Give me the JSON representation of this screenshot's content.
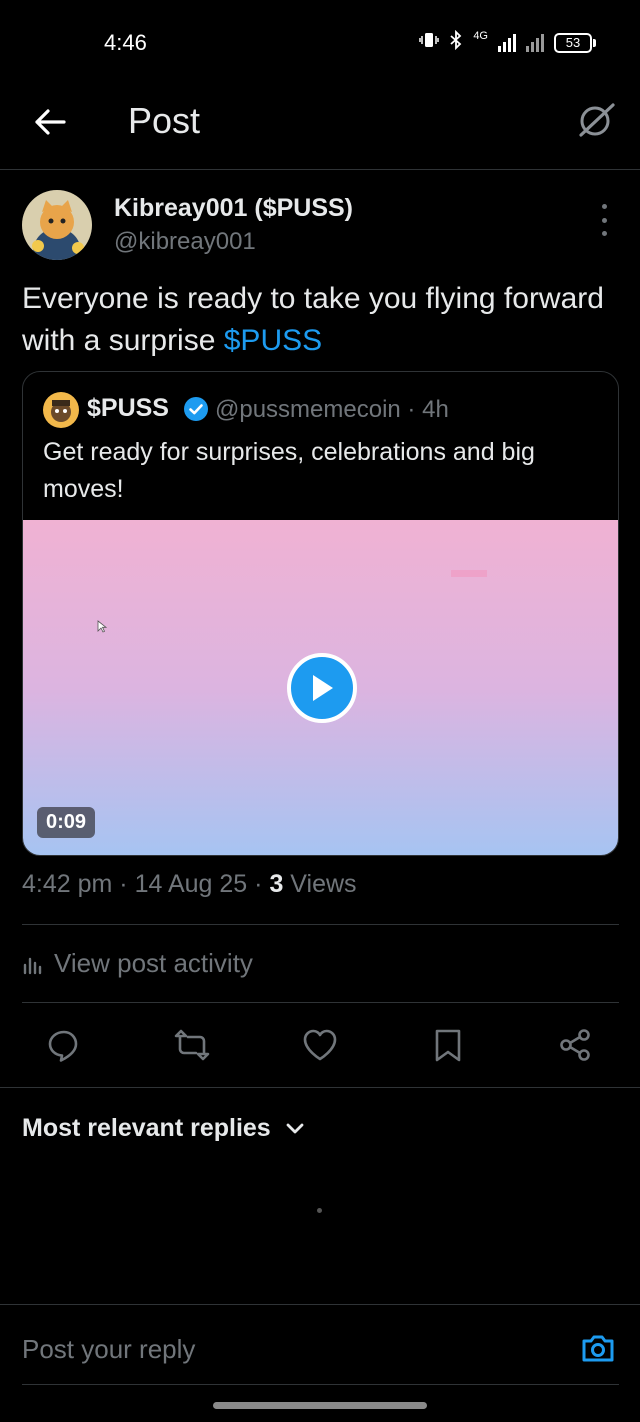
{
  "status_bar": {
    "time": "4:46",
    "network": "4G",
    "battery": "53"
  },
  "header": {
    "title": "Post",
    "back_icon": "arrow-left-icon",
    "grok_icon": "grok-icon"
  },
  "post": {
    "author_name": "Kibreay001 ($PUSS)",
    "author_handle": "@kibreay001",
    "text_before": "Everyone is ready to take you flying forward with a surprise ",
    "cashtag": "$PUSS",
    "timestamp": "4:42 pm",
    "date": "14 Aug 25",
    "views_count": "3",
    "views_label": "Views",
    "separator": "·"
  },
  "quoted_post": {
    "name": "$PUSS",
    "handle": "@pussmemecoin · 4h",
    "text": "Get ready for surprises, celebrations and big moves!",
    "video_duration": "0:09",
    "verified": true
  },
  "activity": {
    "label": "View post activity"
  },
  "actions": [
    "reply-icon",
    "repost-icon",
    "like-icon",
    "bookmark-icon",
    "share-icon"
  ],
  "replies": {
    "sort_label": "Most relevant replies"
  },
  "reply_box": {
    "placeholder": "Post your reply"
  },
  "colors": {
    "background": "#000000",
    "accent": "#1d9bf0",
    "text": "#e7e9ea",
    "muted": "#71767b",
    "divider": "#2f3336"
  }
}
